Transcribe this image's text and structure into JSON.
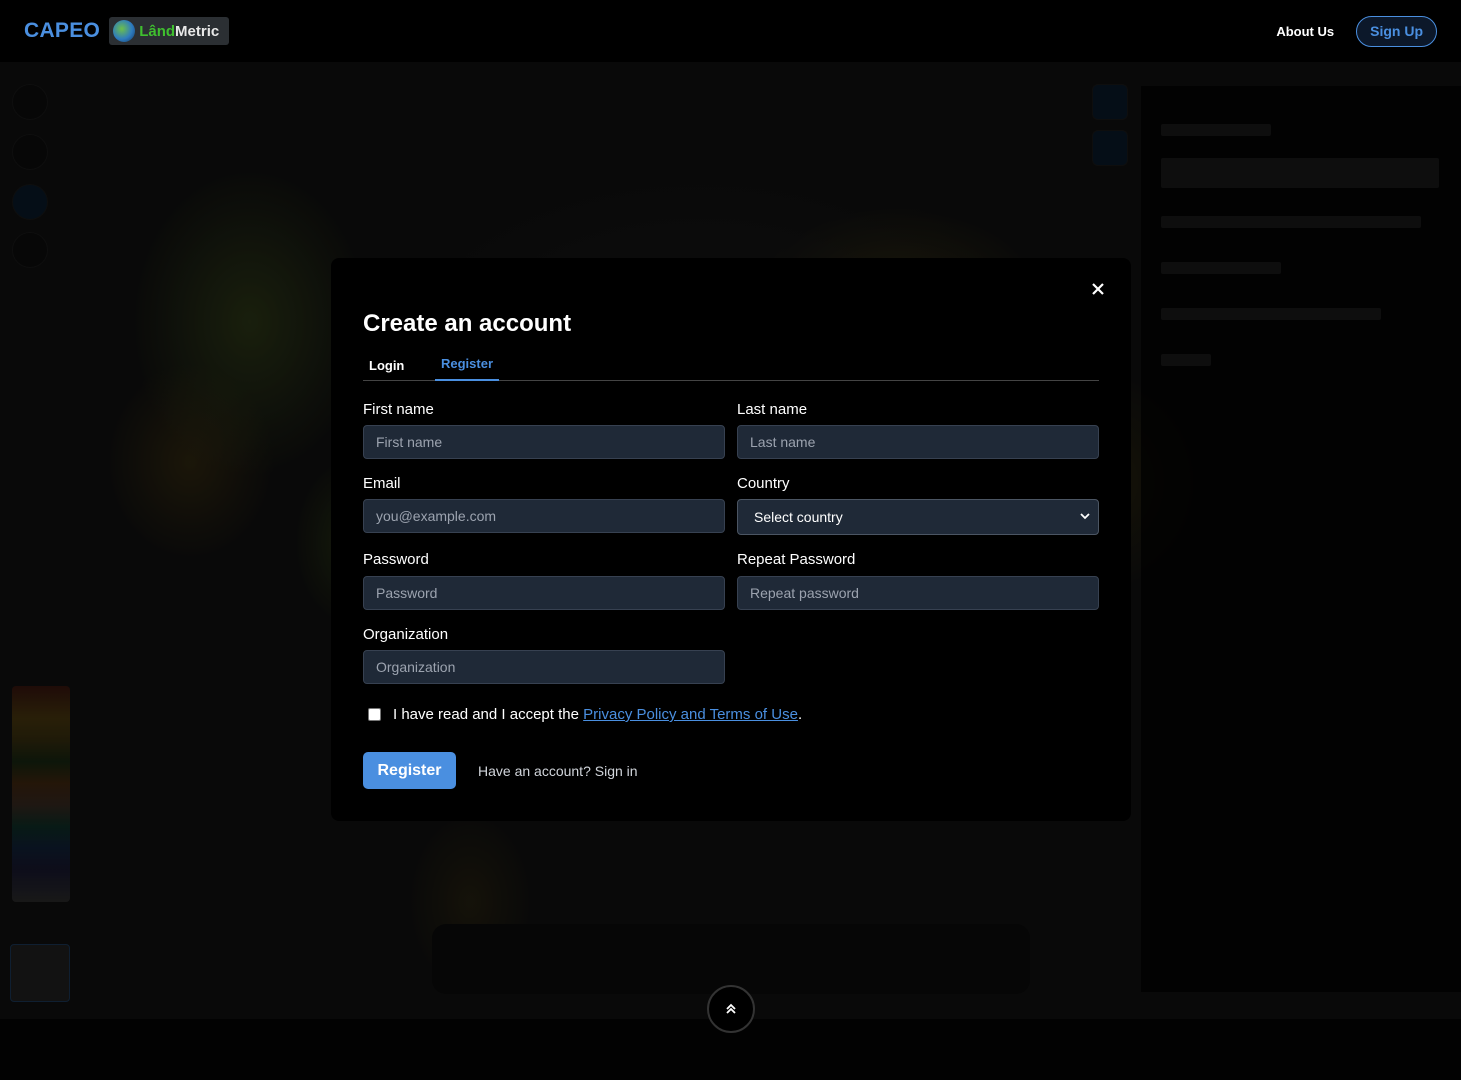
{
  "header": {
    "brand": "CAPEO",
    "logo_text_green": "Lând",
    "logo_text_white": "Metric",
    "about_label": "About Us",
    "signup_label": "Sign Up"
  },
  "modal": {
    "title": "Create an account",
    "tabs": [
      {
        "label": "Login",
        "active": false
      },
      {
        "label": "Register",
        "active": true
      }
    ],
    "fields": {
      "first_name": {
        "label": "First name",
        "placeholder": "First name",
        "value": ""
      },
      "last_name": {
        "label": "Last name",
        "placeholder": "Last name",
        "value": ""
      },
      "email": {
        "label": "Email",
        "placeholder": "you@example.com",
        "value": ""
      },
      "country": {
        "label": "Country",
        "selected": "Select country"
      },
      "password": {
        "label": "Password",
        "placeholder": "Password",
        "value": ""
      },
      "repeat_password": {
        "label": "Repeat Password",
        "placeholder": "Repeat password",
        "value": ""
      },
      "organization": {
        "label": "Organization",
        "placeholder": "Organization",
        "value": ""
      }
    },
    "terms": {
      "prefix": "I have read and I accept the",
      "link": "Privacy Policy and Terms of Use",
      "suffix": ".",
      "checked": false
    },
    "register_button": "Register",
    "signin_prompt": "Have an account? Sign in"
  },
  "colors": {
    "accent": "#4a8fe0",
    "input_bg": "#1f2937",
    "modal_bg": "#000000"
  },
  "icons": {
    "close": "close-icon",
    "select_arrow": "chevron-down-icon",
    "expand_up": "double-chevron-up-icon"
  }
}
